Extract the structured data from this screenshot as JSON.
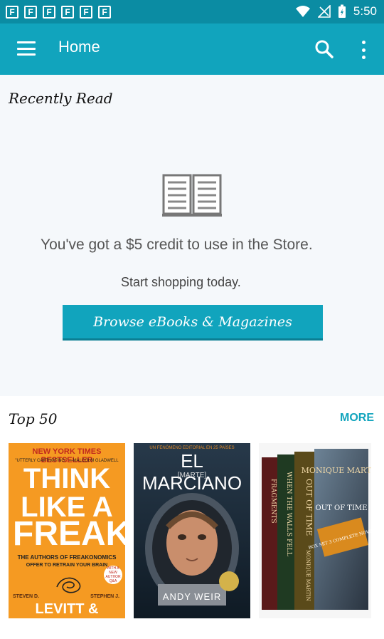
{
  "status_bar": {
    "notification_icons": [
      "F",
      "F",
      "F",
      "F",
      "F",
      "F"
    ],
    "time": "5:50"
  },
  "toolbar": {
    "title": "Home",
    "menu_icon": "hamburger-menu-icon",
    "search_icon": "search-icon",
    "more_icon": "more-vert-icon",
    "color": "#11a4bd"
  },
  "recently_read": {
    "heading": "Recently Read",
    "icon": "open-book-icon",
    "credit_message": "You've got a $5 credit to use in the Store.",
    "shop_message": "Start shopping today.",
    "browse_button": "Browse eBooks & Magazines"
  },
  "top50": {
    "heading": "Top 50",
    "more_link": "MORE",
    "books": [
      {
        "banner": "NEW YORK TIMES BESTSELLER",
        "quote": "\"UTTERLY CAPTIVATING.\" —MALCOLM GLADWELL",
        "line1": "THINK",
        "line2": "LIKE A",
        "line3": "FREAK",
        "authors_line": "THE AUTHORS OF FREAKONOMICS",
        "sub_line": "OFFER TO RETRAIN YOUR BRAIN",
        "badge": "WITH A NEW AUTHOR Q&A",
        "first_names": [
          "STEVEN D.",
          "STEPHEN J."
        ],
        "surnames": "LEVITT & DUBNER"
      },
      {
        "publisher": "UN FENÓMENO EDITORIAL EN 25 PAÍSES",
        "title": "EL MARCIANO",
        "subtitle": "[MARTE]",
        "author": "ANDY WEIR"
      },
      {
        "spines": [
          "FRAGMENTS",
          "WHEN THE WALLS FELL",
          "OUT OF TIME"
        ],
        "spine_author": "MONIQUE MARTIN",
        "front_author": "MONIQUE MARTIN",
        "front_title": "OUT OF TIME",
        "front_banner": "BOX SET 3 COMPLETE NOVELS"
      }
    ]
  }
}
